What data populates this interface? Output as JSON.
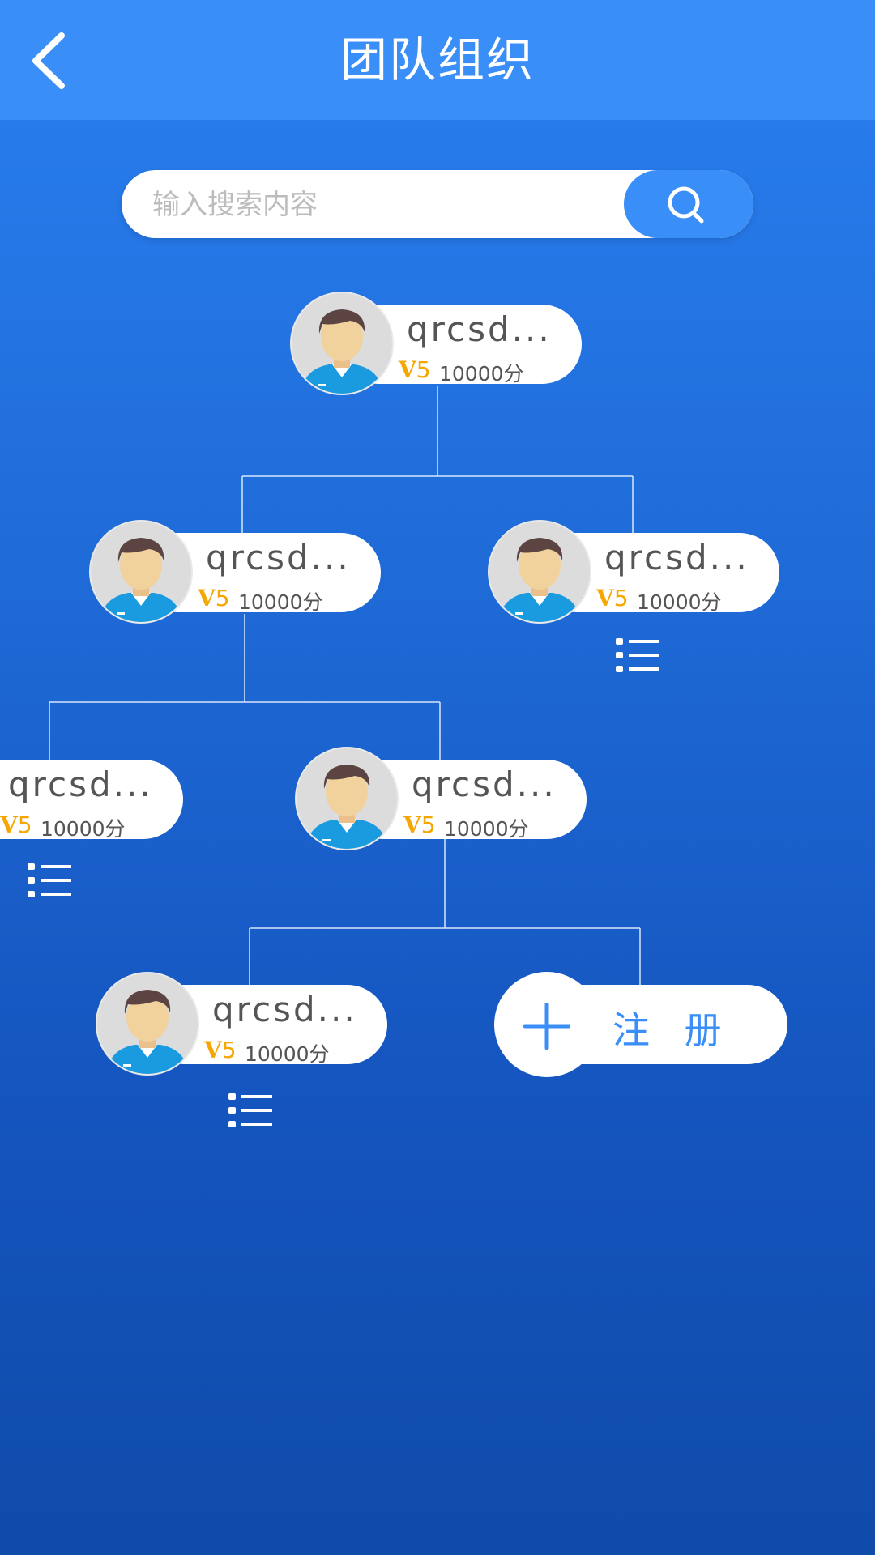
{
  "header": {
    "title": "团队组织",
    "back_icon": "chevron-left-icon"
  },
  "search": {
    "placeholder": "输入搜索内容",
    "value": "",
    "icon": "search-icon"
  },
  "members": [
    {
      "name": "qrcsd...",
      "level": "V",
      "level_num": "5",
      "points": "10000分"
    },
    {
      "name": "qrcsd...",
      "level": "V",
      "level_num": "5",
      "points": "10000分"
    },
    {
      "name": "qrcsd...",
      "level": "V",
      "level_num": "5",
      "points": "10000分"
    },
    {
      "name": "qrcsd...",
      "level": "V",
      "level_num": "5",
      "points": "10000分"
    },
    {
      "name": "qrcsd...",
      "level": "V",
      "level_num": "5",
      "points": "10000分"
    },
    {
      "name": "qrcsd...",
      "level": "V",
      "level_num": "5",
      "points": "10000分"
    }
  ],
  "register": {
    "label": "注 册",
    "icon": "plus-icon"
  },
  "colors": {
    "header": "#3a8ef8",
    "accent": "#3a8ef8",
    "level": "#f5a600",
    "background_top": "#2a7ff0",
    "background_bottom": "#0f4ba9"
  }
}
